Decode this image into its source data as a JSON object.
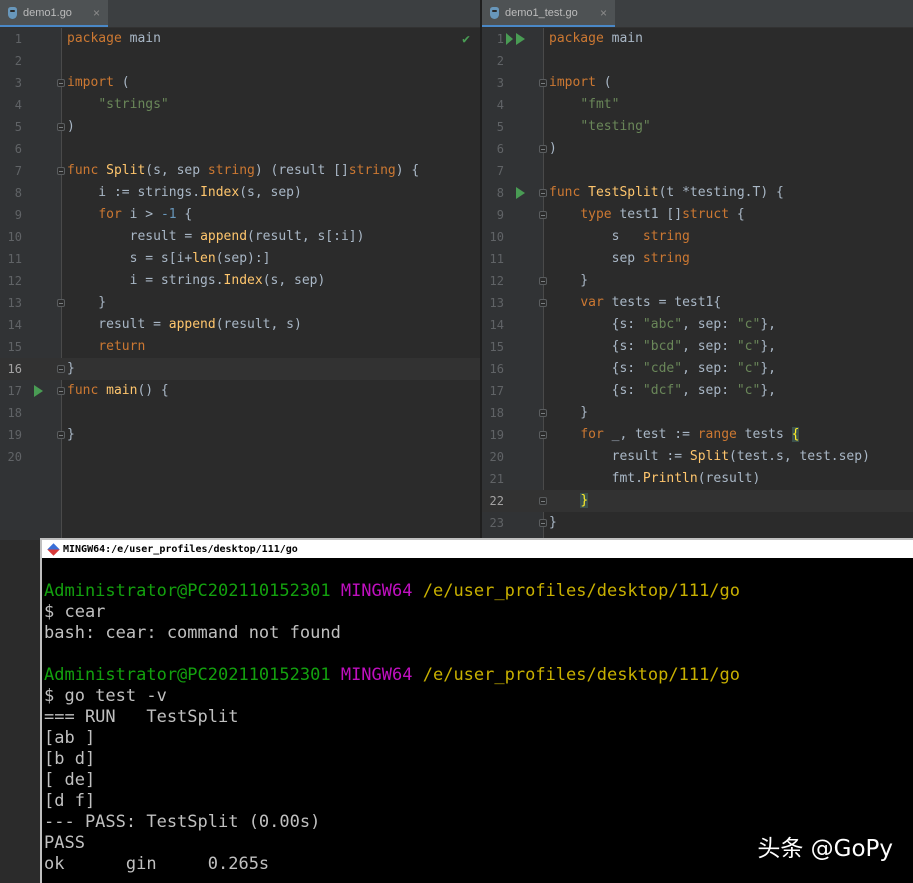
{
  "editor": {
    "left": {
      "tab_label": "demo1.go",
      "current_line": 16,
      "lines": [
        {
          "n": "1",
          "html": "<span class='kw'>package</span> <span class='fn' style='color:#a9b7c6'>main</span>"
        },
        {
          "n": "2",
          "html": ""
        },
        {
          "n": "3",
          "html": "<span class='kw'>import</span> ("
        },
        {
          "n": "4",
          "html": "    <span class='str'>\"strings\"</span>"
        },
        {
          "n": "5",
          "html": ")"
        },
        {
          "n": "6",
          "html": ""
        },
        {
          "n": "7",
          "html": "<span class='kw'>func</span> <span class='fn'>Split</span>(s, sep <span class='kw'>string</span>) (result []<span class='kw'>string</span>) {"
        },
        {
          "n": "8",
          "html": "    i := strings.<span class='fn'>Index</span>(s, sep)"
        },
        {
          "n": "9",
          "html": "    <span class='kw'>for</span> i &gt; <span class='num'>-1</span> {"
        },
        {
          "n": "10",
          "html": "        result = <span class='fn'>append</span>(result, s[:i])"
        },
        {
          "n": "11",
          "html": "        s = s[i+<span class='fn'>len</span>(sep):]"
        },
        {
          "n": "12",
          "html": "        i = strings.<span class='fn'>Index</span>(s, sep)"
        },
        {
          "n": "13",
          "html": "    }"
        },
        {
          "n": "14",
          "html": "    result = <span class='fn'>append</span>(result, s)"
        },
        {
          "n": "15",
          "html": "    <span class='kw'>return</span>"
        },
        {
          "n": "16",
          "html": "}"
        },
        {
          "n": "17",
          "html": "<span class='kw'>func</span> <span class='fn'>main</span>() {"
        },
        {
          "n": "18",
          "html": ""
        },
        {
          "n": "19",
          "html": "}"
        },
        {
          "n": "20",
          "html": ""
        }
      ],
      "run_markers": [
        17
      ],
      "fold_markers": [
        3,
        5,
        7,
        13,
        16,
        17,
        19
      ]
    },
    "right": {
      "tab_label": "demo1_test.go",
      "current_line": 22,
      "lines": [
        {
          "n": "1",
          "html": "<span class='kw'>package</span> main"
        },
        {
          "n": "2",
          "html": ""
        },
        {
          "n": "3",
          "html": "<span class='kw'>import</span> ("
        },
        {
          "n": "4",
          "html": "    <span class='str'>\"fmt\"</span>"
        },
        {
          "n": "5",
          "html": "    <span class='str'>\"testing\"</span>"
        },
        {
          "n": "6",
          "html": ")"
        },
        {
          "n": "7",
          "html": ""
        },
        {
          "n": "8",
          "html": "<span class='kw'>func</span> <span class='fn'>TestSplit</span>(t *testing.T) {"
        },
        {
          "n": "9",
          "html": "    <span class='kw'>type</span> test1 []<span class='kw'>struct</span> {"
        },
        {
          "n": "10",
          "html": "        s   <span class='kw'>string</span>"
        },
        {
          "n": "11",
          "html": "        sep <span class='kw'>string</span>"
        },
        {
          "n": "12",
          "html": "    }"
        },
        {
          "n": "13",
          "html": "    <span class='kw'>var</span> tests = test1{"
        },
        {
          "n": "14",
          "html": "        {s: <span class='str'>\"abc\"</span>, sep: <span class='str'>\"c\"</span>},"
        },
        {
          "n": "15",
          "html": "        {s: <span class='str'>\"bcd\"</span>, sep: <span class='str'>\"c\"</span>},"
        },
        {
          "n": "16",
          "html": "        {s: <span class='str'>\"cde\"</span>, sep: <span class='str'>\"c\"</span>},"
        },
        {
          "n": "17",
          "html": "        {s: <span class='str'>\"dcf\"</span>, sep: <span class='str'>\"c\"</span>},"
        },
        {
          "n": "18",
          "html": "    }"
        },
        {
          "n": "19",
          "html": "    <span class='kw'>for</span> _, test := <span class='kw'>range</span> tests <span class='bracket-hl'>{</span>"
        },
        {
          "n": "20",
          "html": "        result := <span class='fn'>Split</span>(test.s, test.sep)"
        },
        {
          "n": "21",
          "html": "        fmt.<span class='fn'>Println</span>(result)"
        },
        {
          "n": "22",
          "html": "    <span class='bracket-hl'>}</span>"
        },
        {
          "n": "23",
          "html": "}"
        }
      ],
      "run_markers": [
        1,
        8
      ],
      "double_run_markers": [
        1
      ],
      "fold_markers": [
        3,
        6,
        8,
        9,
        12,
        13,
        18,
        19,
        22,
        23
      ]
    }
  },
  "terminal": {
    "title": "MINGW64:/e/user_profiles/desktop/111/go",
    "lines": [
      {
        "type": "blank"
      },
      {
        "type": "prompt",
        "user": "Administrator@PC202110152301",
        "host": "MINGW64",
        "path": "/e/user_profiles/desktop/111/go"
      },
      {
        "type": "text",
        "text": "$ cear"
      },
      {
        "type": "text",
        "text": "bash: cear: command not found"
      },
      {
        "type": "blank"
      },
      {
        "type": "prompt",
        "user": "Administrator@PC202110152301",
        "host": "MINGW64",
        "path": "/e/user_profiles/desktop/111/go"
      },
      {
        "type": "text",
        "text": "$ go test -v"
      },
      {
        "type": "text",
        "text": "=== RUN   TestSplit"
      },
      {
        "type": "text",
        "text": "[ab ]"
      },
      {
        "type": "text",
        "text": "[b d]"
      },
      {
        "type": "text",
        "text": "[ de]"
      },
      {
        "type": "text",
        "text": "[d f]"
      },
      {
        "type": "text",
        "text": "--- PASS: TestSplit (0.00s)"
      },
      {
        "type": "text",
        "text": "PASS"
      },
      {
        "type": "text",
        "text": "ok      gin     0.265s"
      }
    ]
  },
  "watermark": "头条 @GoPy"
}
